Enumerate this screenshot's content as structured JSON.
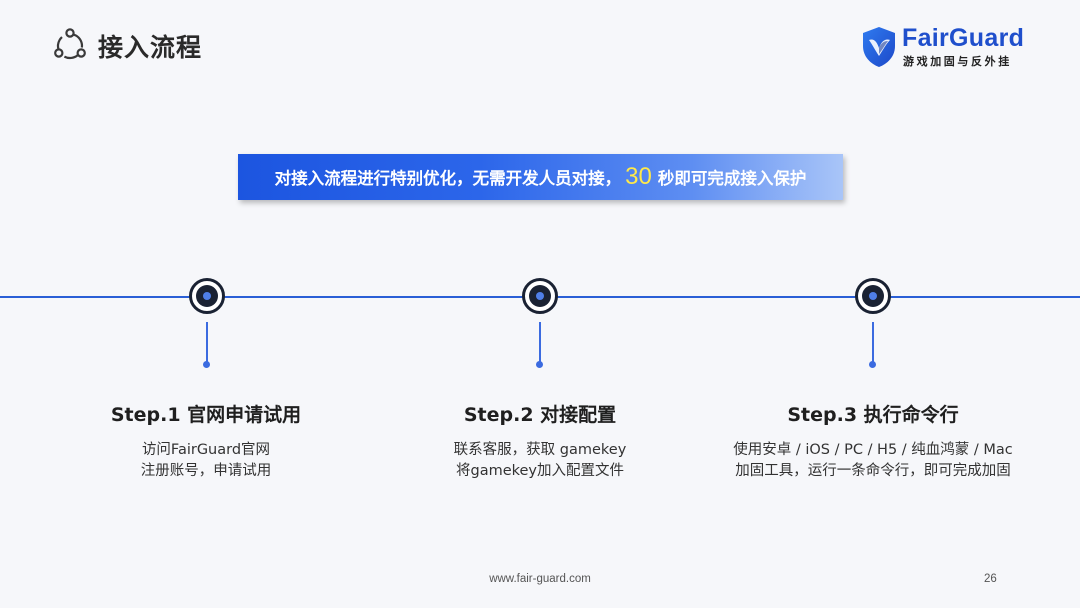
{
  "header": {
    "icon": "share-nodes-icon",
    "title": "接入流程"
  },
  "logo": {
    "name": "FairGuard",
    "tagline": "游戏加固与反外挂",
    "brand_color": "#1f4fcc"
  },
  "banner": {
    "text_before": "对接入流程进行特别优化，无需开发人员对接，",
    "highlight": "30",
    "text_after": "秒即可完成接入保护",
    "highlight_color": "#ffe94a"
  },
  "steps": [
    {
      "title": "Step.1 官网申请试用",
      "lines": [
        "访问FairGuard官网",
        "注册账号，申请试用"
      ]
    },
    {
      "title": "Step.2 对接配置",
      "lines": [
        "联系客服，获取 gamekey",
        "将gamekey加入配置文件"
      ]
    },
    {
      "title": "Step.3 执行命令行",
      "lines": [
        "使用安卓 / iOS / PC / H5 / 纯血鸿蒙 / Mac",
        "加固工具，运行一条命令行，即可完成加固"
      ]
    }
  ],
  "footer": {
    "url": "www.fair-guard.com",
    "page_number": "26"
  },
  "colors": {
    "accent": "#2a5fd6",
    "node_dark": "#1a2233"
  }
}
